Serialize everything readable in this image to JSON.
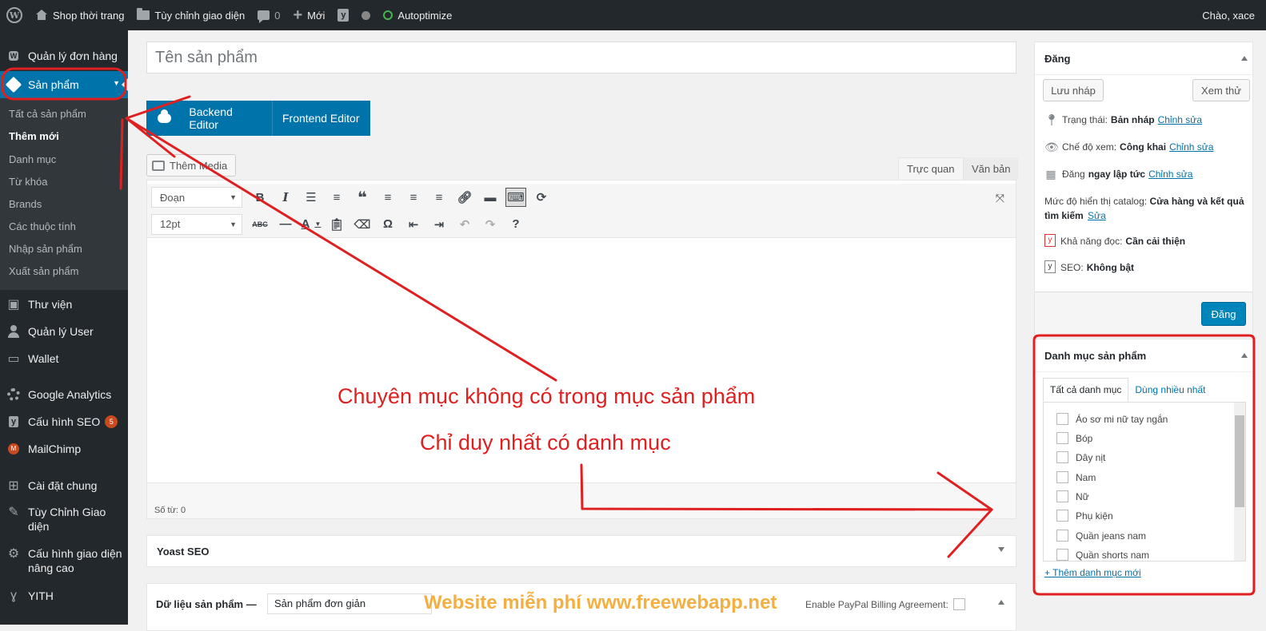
{
  "adminbar": {
    "site_name": "Shop thời trang",
    "customize": "Tùy chỉnh giao diện",
    "comments_count": "0",
    "new": "Mới",
    "autoptimize": "Autoptimize",
    "greeting": "Chào, xace"
  },
  "sidebar": {
    "items": [
      {
        "label": "Quản lý đơn hàng"
      },
      {
        "label": "Sản phẩm"
      },
      {
        "label": "Thư viện"
      },
      {
        "label": "Quản lý User"
      },
      {
        "label": "Wallet"
      },
      {
        "label": "Google Analytics"
      },
      {
        "label": "Cấu hình SEO",
        "badge": "5"
      },
      {
        "label": "MailChimp"
      },
      {
        "label": "Cài đặt chung"
      },
      {
        "label": "Tùy Chỉnh Giao diện"
      },
      {
        "label": "Cấu hình giao diện nâng cao"
      },
      {
        "label": "YITH"
      }
    ],
    "submenu": [
      "Tất cả sản phẩm",
      "Thêm mới",
      "Danh mục",
      "Từ khóa",
      "Brands",
      "Các thuộc tính",
      "Nhập sản phẩm",
      "Xuất sản phẩm"
    ]
  },
  "editor": {
    "title_placeholder": "Tên sản phẩm",
    "backend_editor": "Backend Editor",
    "frontend_editor": "Frontend Editor",
    "add_media": "Thêm Media",
    "tab_visual": "Trực quan",
    "tab_text": "Văn bản",
    "format_select": "Đoạn",
    "size_select": "12pt",
    "word_count": "Số từ: 0"
  },
  "yoast": {
    "title": "Yoast SEO"
  },
  "product_data": {
    "title": "Dữ liệu sản phẩm —",
    "type": "Sản phẩm đơn giản",
    "paypal": "Enable PayPal Billing Agreement:"
  },
  "publish": {
    "title": "Đăng",
    "save_draft": "Lưu nháp",
    "preview": "Xem thử",
    "status_label": "Trạng thái:",
    "status_value": "Bản nháp",
    "visibility_label": "Chế độ xem:",
    "visibility_value": "Công khai",
    "publish_label": "Đăng",
    "publish_value": "ngay lập tức",
    "catalog_label": "Mức độ hiển thị catalog:",
    "catalog_value": "Cửa hàng và kết quả tìm kiếm",
    "readability_label": "Khả năng đọc:",
    "readability_value": "Cần cải thiện",
    "seo_label": "SEO:",
    "seo_value": "Không bật",
    "edit_link": "Chỉnh sửa",
    "edit_short": "Sửa",
    "publish_button": "Đăng"
  },
  "categories": {
    "title": "Danh mục sản phẩm",
    "tab_all": "Tất cả danh mục",
    "tab_popular": "Dùng nhiều nhất",
    "items": [
      "Áo sơ mi nữ tay ngắn",
      "Bóp",
      "Dây nịt",
      "Nam",
      "Nữ",
      "Phụ kiện",
      "Quần jeans nam",
      "Quần shorts nam"
    ],
    "add_new": "+ Thêm danh mục mới"
  },
  "annotations": {
    "line1": "Chuyên mục không có trong mục sản phẩm",
    "line2": "Chỉ duy nhất có danh mục",
    "color": "#e02020"
  },
  "watermark": "Website miễn phí www.freewebapp.net"
}
